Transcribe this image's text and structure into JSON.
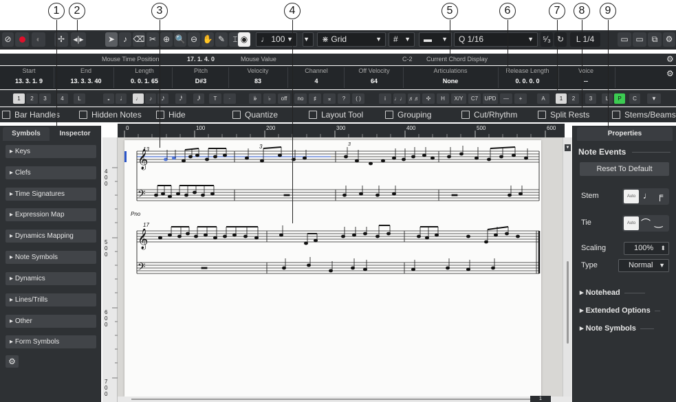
{
  "callouts": [
    "1",
    "2",
    "3",
    "4",
    "5",
    "6",
    "7",
    "8",
    "9"
  ],
  "toolbar": {
    "velocity_value": "100",
    "snap_mode": "Grid",
    "quantize_value": "1/16",
    "length_value": "1/4"
  },
  "status": {
    "mouse_time_label": "Mouse Time Position",
    "mouse_time_value": "17. 1. 4.   0",
    "mouse_value_label": "Mouse Value",
    "pitch_value": "C-2",
    "chord_display": "Current Chord Display"
  },
  "infoline": {
    "columns": [
      {
        "label": "Start",
        "value": "13. 3. 1. 9"
      },
      {
        "label": "End",
        "value": "13. 3. 3. 40"
      },
      {
        "label": "Length",
        "value": "0. 0. 1. 65"
      },
      {
        "label": "Pitch",
        "value": "D#3"
      },
      {
        "label": "Velocity",
        "value": "83"
      },
      {
        "label": "Channel",
        "value": "4"
      },
      {
        "label": "Off Velocity",
        "value": "64"
      },
      {
        "label": "Articulations",
        "value": "None"
      },
      {
        "label": "Release Length",
        "value": "0. 0. 0.   0"
      },
      {
        "label": "Voice",
        "value": "--"
      }
    ]
  },
  "strip": {
    "voices_left": [
      "1",
      "2",
      "3",
      "4",
      "L"
    ],
    "note_values": [
      "𝅝",
      "𝅗𝅥",
      "♩",
      "♪",
      "𝅘𝅥𝅯",
      "𝅘𝅥𝅰",
      "𝅘𝅥𝅱",
      "T",
      "·"
    ],
    "accidentals": [
      "𝄫",
      "♭",
      "off",
      "no",
      "♯",
      "𝄪",
      "?",
      "( )"
    ],
    "text_tools": [
      "i",
      "♩♩",
      "♬♬",
      "✣",
      "H",
      "X/Y",
      "C7",
      "UPD",
      "—",
      "+"
    ],
    "auto_label": "A",
    "voices_right": [
      "1",
      "2",
      "3",
      "L",
      "P",
      "C"
    ]
  },
  "filters": [
    {
      "label": "Bar Handles"
    },
    {
      "label": "Hidden Notes"
    },
    {
      "label": "Hide"
    },
    {
      "label": "Quantize"
    },
    {
      "label": "Layout Tool"
    },
    {
      "label": "Grouping"
    },
    {
      "label": "Cut/Rhythm"
    },
    {
      "label": "Split Rests"
    },
    {
      "label": "Stems/Beams"
    }
  ],
  "left_panel": {
    "tabs": [
      "Symbols",
      "Inspector"
    ],
    "items": [
      "Keys",
      "Clefs",
      "Time Signatures",
      "Expression Map",
      "Dynamics Mapping",
      "Note Symbols",
      "Dynamics",
      "Lines/Trills",
      "Other",
      "Form Symbols"
    ]
  },
  "ruler": {
    "marks": [
      "0",
      "100",
      "200",
      "300",
      "400",
      "500",
      "600"
    ],
    "vertical": [
      "4",
      "0",
      "0",
      "5",
      "0",
      "0",
      "6",
      "0",
      "0",
      "7",
      "0",
      "0"
    ]
  },
  "score": {
    "measure_13": "13",
    "measure_17": "17",
    "instrument": "Pno",
    "triplet_a": "3",
    "triplet_b": "3",
    "page_number": "1"
  },
  "right_panel": {
    "title": "Properties",
    "section": "Note Events",
    "reset_label": "Reset To Default",
    "stem_label": "Stem",
    "tie_label": "Tie",
    "auto_label": "Auto",
    "scaling_label": "Scaling",
    "scaling_value": "100%",
    "type_label": "Type",
    "type_value": "Normal",
    "sections": [
      "Notehead",
      "Extended Options",
      "Note Symbols"
    ]
  },
  "colors": {
    "record": "#e0102b",
    "green": "#3ccc52",
    "panel": "#2e3134"
  }
}
